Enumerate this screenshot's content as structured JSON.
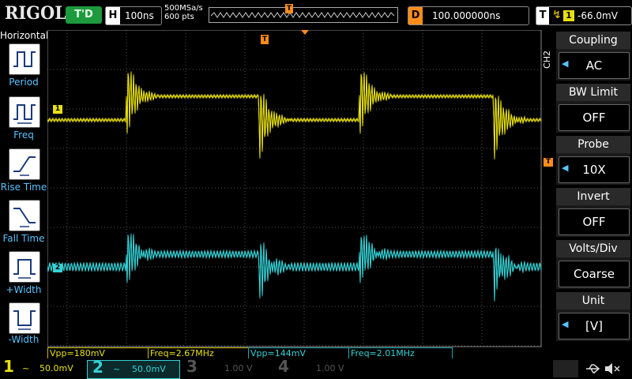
{
  "topbar": {
    "logo": "RIGOL",
    "run_status": "T'D",
    "horizontal_key": "H",
    "timebase": "100ns",
    "sample_rate": "500MSa/s",
    "memory_depth": "600 pts",
    "delay_key": "D",
    "delay_value": "100.000000ns",
    "trigger_key": "T",
    "trigger_source": "1",
    "trigger_level": "-66.0mV"
  },
  "left_menu": {
    "title": "Horizontal",
    "items": [
      {
        "label": "Period",
        "icon": "period-icon"
      },
      {
        "label": "Freq",
        "icon": "frequency-icon"
      },
      {
        "label": "Rise Time",
        "icon": "rise-time-icon"
      },
      {
        "label": "Fall Time",
        "icon": "fall-time-icon"
      },
      {
        "label": "+Width",
        "icon": "positive-width-icon"
      },
      {
        "label": "-Width",
        "icon": "negative-width-icon"
      }
    ]
  },
  "right_menu": {
    "channel_tag": "CH2",
    "items": [
      {
        "title": "Coupling",
        "value": "AC",
        "has_arrow": true
      },
      {
        "title": "BW Limit",
        "value": "OFF",
        "has_arrow": false
      },
      {
        "title": "Probe",
        "value": "10X",
        "has_arrow": true
      },
      {
        "title": "Invert",
        "value": "OFF",
        "has_arrow": false
      },
      {
        "title": "Volts/Div",
        "value": "Coarse",
        "has_arrow": false
      },
      {
        "title": "Unit",
        "value": "[V]",
        "has_arrow": true
      }
    ]
  },
  "markers": {
    "ch1_marker": "1",
    "ch2_marker": "2",
    "trigger_marker": "T",
    "trigger_level_marker": "T"
  },
  "measurements": [
    {
      "text": "Vpp=180mV",
      "channel": 1
    },
    {
      "text": "Freq=2.67MHz",
      "channel": 1
    },
    {
      "text": "Vpp=144mV",
      "channel": 2
    },
    {
      "text": "Freq=2.01MHz",
      "channel": 2
    }
  ],
  "channels": [
    {
      "num": "1",
      "coupling": "~",
      "scale": "50.0mV",
      "color": "#e8e010",
      "active": true
    },
    {
      "num": "2",
      "coupling": "~",
      "scale": "50.0mV",
      "color": "#35d2d6",
      "active": true
    },
    {
      "num": "3",
      "coupling": "",
      "scale": "1.00 V",
      "color": "#555555",
      "active": false
    },
    {
      "num": "4",
      "coupling": "",
      "scale": "1.00 V",
      "color": "#555555",
      "active": false
    }
  ],
  "colors": {
    "ch1": "#e8e010",
    "ch2": "#35d2d6",
    "trigger": "#ff8c1a",
    "menu_accent": "#57c4ff"
  },
  "status_icons": [
    "usb-icon",
    "mute-icon"
  ]
}
